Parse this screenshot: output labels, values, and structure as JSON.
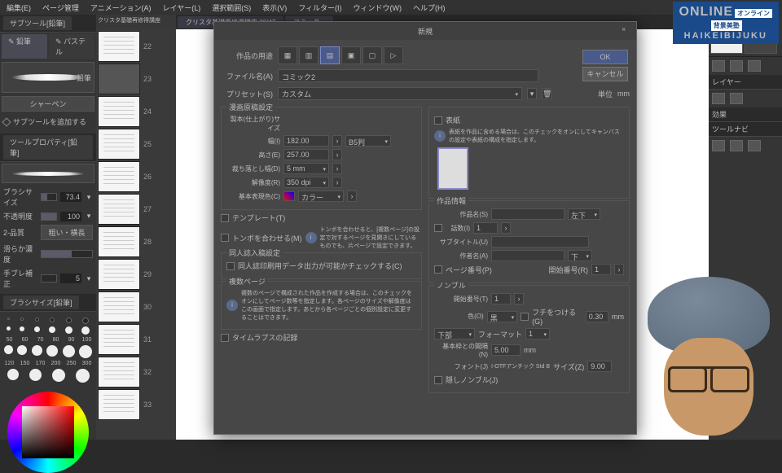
{
  "menu": [
    "編集(E)",
    "ページ管理",
    "アニメーション(A)",
    "レイヤー(L)",
    "選択範囲(S)",
    "表示(V)",
    "フィルター(I)",
    "ウィンドウ(W)",
    "ヘルプ(H)"
  ],
  "subtools": {
    "panel": "サブツール[鉛筆]",
    "tab1": "鉛筆",
    "tab2": "パステル",
    "brush_label": "鉛筆",
    "sharp": "シャーペン",
    "add": "サブツールを追加する"
  },
  "toolprop": {
    "panel": "ツールプロパティ[鉛筆]",
    "size": "ブラシサイズ",
    "size_v": "73.4",
    "opacity": "不透明度",
    "opacity_v": "100",
    "aa": "2-品質",
    "aa_v": "粗い・横長",
    "stabil": "滑らか濃度",
    "tilt": "手ブレ補正",
    "tilt_v": "5"
  },
  "brushsize": {
    "panel": "ブラシサイズ[鉛筆]",
    "sizes": [
      "50",
      "60",
      "70",
      "80",
      "90",
      "100",
      "120",
      "150",
      "170",
      "200",
      "250",
      "300"
    ]
  },
  "thumbs": {
    "tab1": "クリスタ基礎再修得講座",
    "tab2": "クリスタ基礎再修得講座 30/47",
    "tab3": "コミック..."
  },
  "right": {
    "layer": "レイヤー",
    "effect": "効果",
    "tool": "ツールナビ"
  },
  "dialog": {
    "title": "新規",
    "ok": "OK",
    "cancel": "キャンセル",
    "purpose": "作品の用途",
    "filename_lbl": "ファイル名(A)",
    "filename": "コミック2",
    "preset_lbl": "プリセット(S)",
    "preset": "カスタム",
    "unit_lbl": "単位",
    "unit": "mm",
    "binding": {
      "legend": "漫画原稿設定",
      "size_lbl": "製本(仕上がり)サイズ",
      "width": "幅(I)",
      "width_v": "182.00",
      "height": "高さ(E)",
      "height_v": "257.00",
      "paper": "B5判",
      "bleed": "裁ち落とし幅(D)",
      "bleed_v": "5 mm",
      "res": "解像度(R)",
      "res_v": "350 dpi",
      "colormode": "基本表現色(C)",
      "colormode_v": "カラー"
    },
    "template": "テンプレート(T)",
    "trim": "トンボを合わせる(M)",
    "trim_info": "トンボを合わせると、[複数ページ]の設定で対するページを見開きにしているものでも、片ページで設定できます。",
    "fanzine": {
      "legend": "同人誌入稿設定",
      "opt": "同人誌印刷用データ出力が可能かチェックする(C)"
    },
    "multipage": {
      "legend": "複数ページ",
      "info": "複数のページで構成された作品を作成する場合は、このチェックをオンにしてページ数等を指定します。各ページのサイズや解像度はこの画面で指定します。あとから各ページごとの個別設定に変更することはできます。"
    },
    "cover": {
      "legend": "表紙",
      "cb": "表紙",
      "info": "表紙を作品に含める場合は、このチェックをオンにしてキャンバスの設定や表紙の構成を指定します。"
    },
    "workinfo": {
      "legend": "作品情報",
      "title": "作品名(S)",
      "title_pos": "左下",
      "episode": "話数(I)",
      "episode_v": "1",
      "subtitle": "サブタイトル(U)",
      "author": "作者名(A)",
      "author_pos": "下",
      "pagenum": "ページ番号(P)",
      "startpg": "開始番号(R)",
      "startpg_v": "1"
    },
    "nombre": {
      "legend": "ノンブル",
      "start": "開始番号(T)",
      "start_v": "1",
      "color": "色(O)",
      "color_v": "黒",
      "edge": "フチをつける(G)",
      "edge_v": "0.30",
      "edge_u": "mm",
      "pos": "下部",
      "format": "フォーマット",
      "offset": "基本枠との間隔(N)",
      "offset_v": "5.00",
      "offset_u": "mm",
      "font": "フォント(J)",
      "font_v": "I-OTFアンチック Std B",
      "fsize": "サイズ(Z)",
      "fsize_v": "9.00",
      "blind": "隠しノンブル(J)"
    },
    "timelapse": "タイムラプスの記録"
  },
  "watermark": {
    "line1": "ONLINE",
    "jp": "オンライン",
    "jp2": "背景美塾",
    "line2": "HAIKEIBIJUKU"
  }
}
